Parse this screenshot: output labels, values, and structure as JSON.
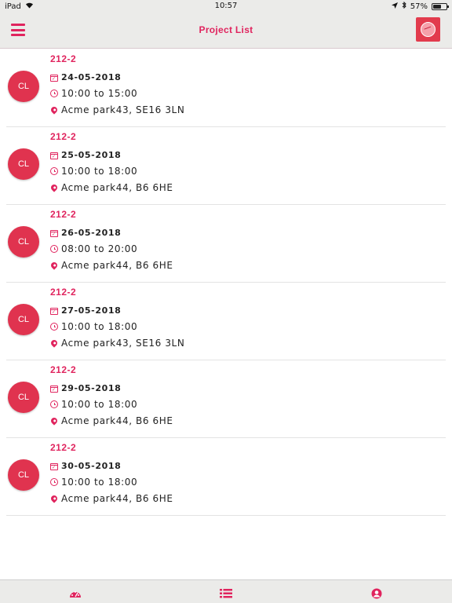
{
  "status_bar": {
    "carrier": "iPad",
    "time": "10:57",
    "battery": "57%"
  },
  "header": {
    "title": "Project List",
    "menu_icon": "hamburger-icon",
    "logo_icon": "app-logo-icon"
  },
  "projects": [
    {
      "avatar": "CL",
      "name": "212-2",
      "date": "24-05-2018",
      "time": "10:00 to 15:00",
      "location": "Acme park43, SE16 3LN"
    },
    {
      "avatar": "CL",
      "name": "212-2",
      "date": "25-05-2018",
      "time": "10:00 to 18:00",
      "location": "Acme park44, B6 6HE"
    },
    {
      "avatar": "CL",
      "name": "212-2",
      "date": "26-05-2018",
      "time": "08:00 to 20:00",
      "location": "Acme park44, B6 6HE"
    },
    {
      "avatar": "CL",
      "name": "212-2",
      "date": "27-05-2018",
      "time": "10:00 to 18:00",
      "location": "Acme park43, SE16 3LN"
    },
    {
      "avatar": "CL",
      "name": "212-2",
      "date": "29-05-2018",
      "time": "10:00 to 18:00",
      "location": "Acme park44, B6 6HE"
    },
    {
      "avatar": "CL",
      "name": "212-2",
      "date": "30-05-2018",
      "time": "10:00 to 18:00",
      "location": "Acme park44, B6 6HE"
    }
  ],
  "tab_bar": {
    "tabs": [
      {
        "icon": "dashboard-icon"
      },
      {
        "icon": "list-icon"
      },
      {
        "icon": "profile-icon"
      }
    ]
  },
  "colors": {
    "accent": "#e0245e",
    "avatar": "#e0334f",
    "bar": "#ebebe9"
  }
}
